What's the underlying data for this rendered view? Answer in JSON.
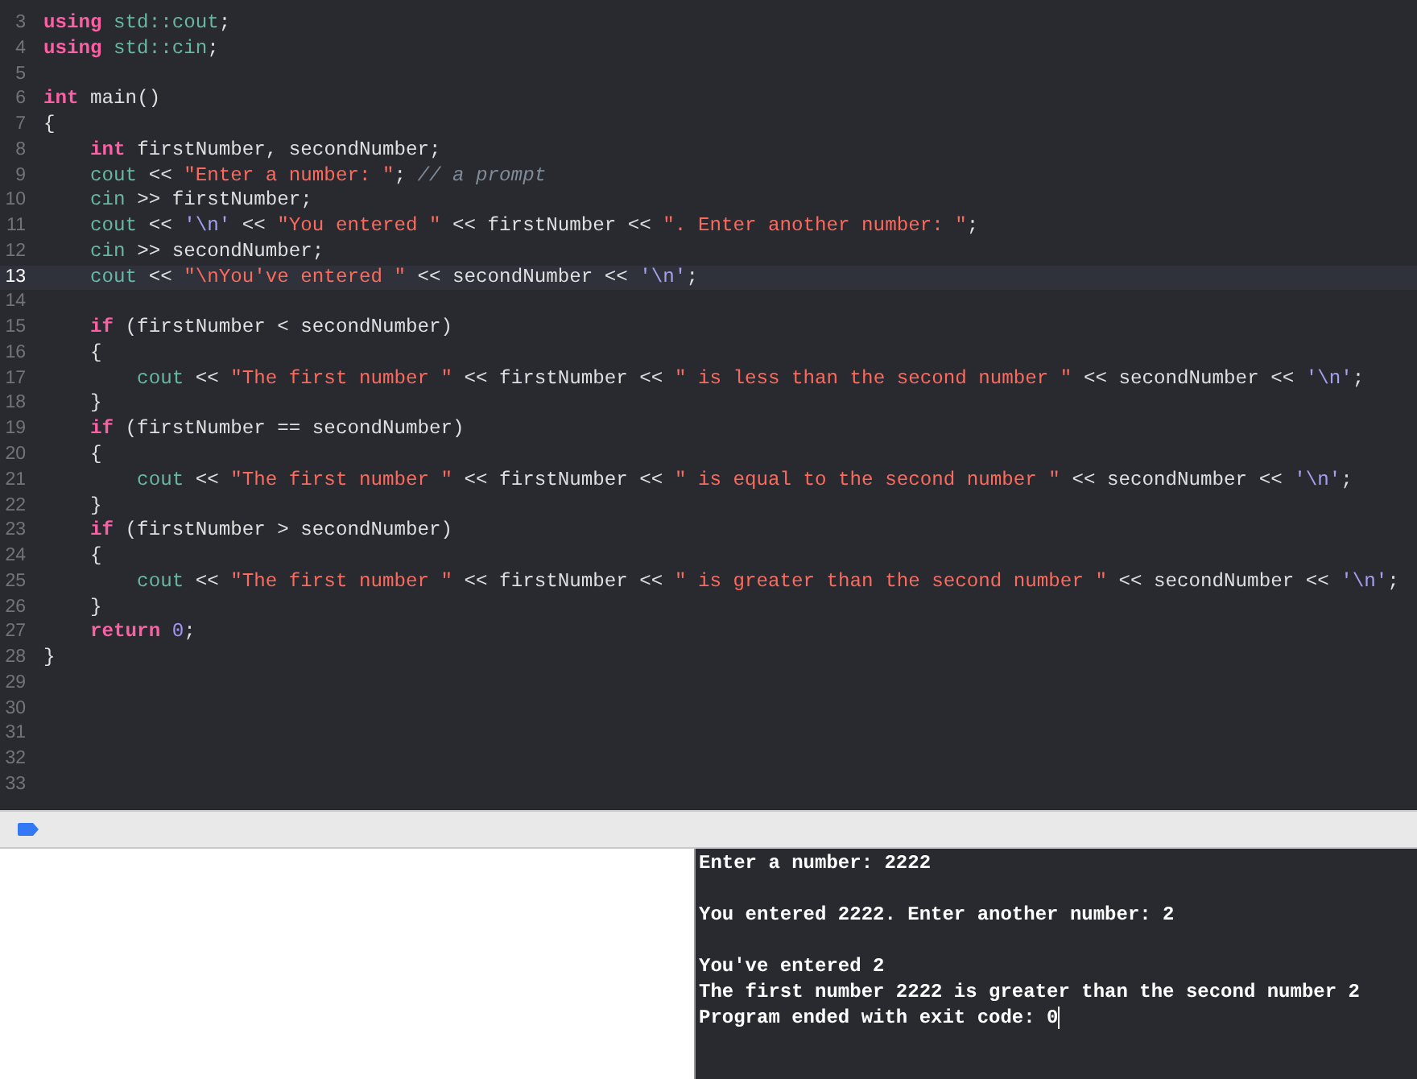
{
  "editor": {
    "lines": [
      {
        "number": "3",
        "current": false,
        "tokens": [
          {
            "kind": "kw",
            "text": "using "
          },
          {
            "kind": "type",
            "text": "std::cout"
          },
          {
            "kind": "plain",
            "text": ";"
          }
        ]
      },
      {
        "number": "4",
        "current": false,
        "tokens": [
          {
            "kind": "kw",
            "text": "using "
          },
          {
            "kind": "type",
            "text": "std::cin"
          },
          {
            "kind": "plain",
            "text": ";"
          }
        ]
      },
      {
        "number": "5",
        "current": false
      },
      {
        "number": "6",
        "current": false,
        "tokens": [
          {
            "kind": "kw",
            "text": "int"
          },
          {
            "kind": "plain",
            "text": " main()"
          }
        ]
      },
      {
        "number": "7",
        "current": false,
        "tokens": [
          {
            "kind": "plain",
            "text": "{"
          }
        ]
      },
      {
        "number": "8",
        "current": false,
        "tokens": [
          {
            "kind": "kw",
            "text": "    int"
          },
          {
            "kind": "plain",
            "text": " firstNumber, secondNumber;"
          }
        ]
      },
      {
        "number": "9",
        "current": false,
        "tokens": [
          {
            "kind": "type",
            "text": "    cout"
          },
          {
            "kind": "plain",
            "text": " << "
          },
          {
            "kind": "str",
            "text": "\"Enter a number: \""
          },
          {
            "kind": "plain",
            "text": "; "
          },
          {
            "kind": "cmt",
            "text": "// a prompt"
          }
        ]
      },
      {
        "number": "10",
        "current": false,
        "tokens": [
          {
            "kind": "type",
            "text": "    cin"
          },
          {
            "kind": "plain",
            "text": " >> firstNumber;"
          }
        ]
      },
      {
        "number": "11",
        "current": false,
        "tokens": [
          {
            "kind": "type",
            "text": "    cout"
          },
          {
            "kind": "plain",
            "text": " << "
          },
          {
            "kind": "chr",
            "text": "'\\n'"
          },
          {
            "kind": "plain",
            "text": " << "
          },
          {
            "kind": "str",
            "text": "\"You entered \""
          },
          {
            "kind": "plain",
            "text": " << firstNumber << "
          },
          {
            "kind": "str",
            "text": "\". Enter another number: \""
          },
          {
            "kind": "plain",
            "text": ";"
          }
        ]
      },
      {
        "number": "12",
        "current": false,
        "tokens": [
          {
            "kind": "type",
            "text": "    cin"
          },
          {
            "kind": "plain",
            "text": " >> secondNumber;"
          }
        ]
      },
      {
        "number": "13",
        "current": true,
        "tokens": [
          {
            "kind": "type",
            "text": "    cout"
          },
          {
            "kind": "plain",
            "text": " << "
          },
          {
            "kind": "str",
            "text": "\"\\nYou've entered \""
          },
          {
            "kind": "plain",
            "text": " << secondNumber << "
          },
          {
            "kind": "chr",
            "text": "'\\n'"
          },
          {
            "kind": "plain",
            "text": ";"
          }
        ]
      },
      {
        "number": "14",
        "current": false
      },
      {
        "number": "15",
        "current": false,
        "tokens": [
          {
            "kind": "kw",
            "text": "    if"
          },
          {
            "kind": "plain",
            "text": " (firstNumber < secondNumber)"
          }
        ]
      },
      {
        "number": "16",
        "current": false,
        "tokens": [
          {
            "kind": "plain",
            "text": "    {"
          }
        ]
      },
      {
        "number": "17",
        "current": false,
        "tokens": [
          {
            "kind": "type",
            "text": "        cout"
          },
          {
            "kind": "plain",
            "text": " << "
          },
          {
            "kind": "str",
            "text": "\"The first number \""
          },
          {
            "kind": "plain",
            "text": " << firstNumber << "
          },
          {
            "kind": "str",
            "text": "\" is less than the second number \""
          },
          {
            "kind": "plain",
            "text": " << secondNumber << "
          },
          {
            "kind": "chr",
            "text": "'\\n'"
          },
          {
            "kind": "plain",
            "text": ";"
          }
        ]
      },
      {
        "number": "18",
        "current": false,
        "tokens": [
          {
            "kind": "plain",
            "text": "    }"
          }
        ]
      },
      {
        "number": "19",
        "current": false,
        "tokens": [
          {
            "kind": "kw",
            "text": "    if"
          },
          {
            "kind": "plain",
            "text": " (firstNumber == secondNumber)"
          }
        ]
      },
      {
        "number": "20",
        "current": false,
        "tokens": [
          {
            "kind": "plain",
            "text": "    {"
          }
        ]
      },
      {
        "number": "21",
        "current": false,
        "tokens": [
          {
            "kind": "type",
            "text": "        cout"
          },
          {
            "kind": "plain",
            "text": " << "
          },
          {
            "kind": "str",
            "text": "\"The first number \""
          },
          {
            "kind": "plain",
            "text": " << firstNumber << "
          },
          {
            "kind": "str",
            "text": "\" is equal to the second number \""
          },
          {
            "kind": "plain",
            "text": " << secondNumber << "
          },
          {
            "kind": "chr",
            "text": "'\\n'"
          },
          {
            "kind": "plain",
            "text": ";"
          }
        ]
      },
      {
        "number": "22",
        "current": false,
        "tokens": [
          {
            "kind": "plain",
            "text": "    }"
          }
        ]
      },
      {
        "number": "23",
        "current": false,
        "tokens": [
          {
            "kind": "kw",
            "text": "    if"
          },
          {
            "kind": "plain",
            "text": " (firstNumber > secondNumber)"
          }
        ]
      },
      {
        "number": "24",
        "current": false,
        "tokens": [
          {
            "kind": "plain",
            "text": "    {"
          }
        ]
      },
      {
        "number": "25",
        "current": false,
        "tokens": [
          {
            "kind": "type",
            "text": "        cout"
          },
          {
            "kind": "plain",
            "text": " << "
          },
          {
            "kind": "str",
            "text": "\"The first number \""
          },
          {
            "kind": "plain",
            "text": " << firstNumber << "
          },
          {
            "kind": "str",
            "text": "\" is greater than the second number \""
          },
          {
            "kind": "plain",
            "text": " << secondNumber << "
          },
          {
            "kind": "chr",
            "text": "'\\n'"
          },
          {
            "kind": "plain",
            "text": ";"
          }
        ]
      },
      {
        "number": "26",
        "current": false,
        "tokens": [
          {
            "kind": "plain",
            "text": "    }"
          }
        ]
      },
      {
        "number": "27",
        "current": false,
        "tokens": [
          {
            "kind": "kw",
            "text": "    return "
          },
          {
            "kind": "num",
            "text": "0"
          },
          {
            "kind": "plain",
            "text": ";"
          }
        ]
      },
      {
        "number": "28",
        "current": false,
        "tokens": [
          {
            "kind": "plain",
            "text": "}"
          }
        ]
      },
      {
        "number": "29",
        "current": false
      },
      {
        "number": "30",
        "current": false
      },
      {
        "number": "31",
        "current": false
      },
      {
        "number": "32",
        "current": false
      },
      {
        "number": "33",
        "current": false
      }
    ]
  },
  "debug_bar": {
    "breakpoints_active": true
  },
  "console": {
    "cursor": true,
    "paragraphs": [
      [
        "Enter a number: 2222"
      ],
      [
        "You entered 2222. Enter another number: 2"
      ],
      [
        "You've entered 2",
        "The first number 2222 is greater than the second number 2",
        "Program ended with exit code: 0"
      ]
    ]
  }
}
